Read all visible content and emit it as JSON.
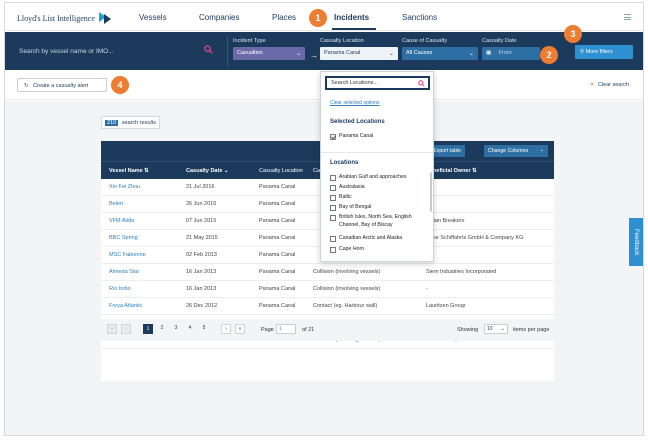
{
  "app": {
    "title": "Lloyd's List Intelligence"
  },
  "nav": {
    "items": [
      {
        "label": "Vessels"
      },
      {
        "label": "Companies"
      },
      {
        "label": "Places"
      },
      {
        "label": "Incidents"
      },
      {
        "label": "Sanctions"
      }
    ]
  },
  "search": {
    "placeholder": "Search by vessel name or IMO..."
  },
  "filters": {
    "incident_type": {
      "label": "Incident Type",
      "value": "Casualties"
    },
    "casualty_location": {
      "label": "Casualty Location",
      "value": "Panama Canal"
    },
    "cause": {
      "label": "Cause of Casualty",
      "value": "All Causes"
    },
    "date": {
      "label": "Casualty Date",
      "value": "From"
    },
    "more_label": "More filters"
  },
  "toolbar": {
    "alert_label": "Create a casualty alert",
    "clear_label": "Clear search"
  },
  "results": {
    "count": "210",
    "label": "search results"
  },
  "table": {
    "export_label": "Export table",
    "columns_label": "Change Columns",
    "headers": {
      "vessel": "Vessel Name",
      "date": "Casualty Date",
      "location": "Casualty Location",
      "type": "Casualty Type",
      "owner": "Beneficial Owner"
    },
    "rows": [
      {
        "vessel": "Xin Fei Zhou",
        "date": "21 Jul 2016",
        "location": "Panama Canal",
        "type": "",
        "owner": ""
      },
      {
        "vessel": "Belen",
        "date": "26 Jun 2016",
        "location": "Panama Canal",
        "type": "",
        "owner": ""
      },
      {
        "vessel": "VFM Alida",
        "date": "07 Jun 2015",
        "location": "Panama Canal",
        "type": "",
        "owner": "Indian Breakers"
      },
      {
        "vessel": "BBC Spring",
        "date": "21 May 2015",
        "location": "Panama Canal",
        "type": "",
        "owner": "Hese Schiffahrts GmbH & Company KG"
      },
      {
        "vessel": "MSC Fabienne",
        "date": "02 Feb 2013",
        "location": "Panama Canal",
        "type": "",
        "owner": ""
      },
      {
        "vessel": "Almeda Star",
        "date": "16 Jan 2013",
        "location": "Panama Canal",
        "type": "Collision (involving vessels)",
        "owner": "Siem Industries Incorporated"
      },
      {
        "vessel": "Rio Indio",
        "date": "16 Jan 2013",
        "location": "Panama Canal",
        "type": "Collision (involving vessels)",
        "owner": "-"
      },
      {
        "vessel": "Freya Atlantic",
        "date": "26 Dec 2012",
        "location": "Panama Canal",
        "type": "Contact (eg. Harbour wall)",
        "owner": "Lauritzen Group"
      },
      {
        "vessel": "Coastal Renaissance",
        "date": "21 Nov 2007",
        "location": "Panama Canal",
        "type": "Contact (eg. Harbour wall)",
        "owner": "-"
      },
      {
        "vessel": "Miltiades",
        "date": "24 Jul 2007",
        "location": "Panama Canal",
        "type": "Collision (involving vessels)",
        "owner": "Nicholas Papalios"
      }
    ]
  },
  "pager": {
    "pages": [
      "1",
      "2",
      "3",
      "4",
      "5"
    ],
    "page_label": "Page",
    "page_value": "1",
    "of_label": "of 21",
    "showing_label": "Showing",
    "per_page": "10",
    "per_page_label": "items per page"
  },
  "dropdown": {
    "search_placeholder": "Search Locations...",
    "clear_label": "Clear selected options",
    "selected_heading": "Selected Locations",
    "selected": [
      "Panama Canal"
    ],
    "locations_heading": "Locations",
    "locations": [
      "Arabian Gulf and approaches",
      "Australasia",
      "Baltic",
      "Bay of Bengal",
      "British Isles, North Sea, English Channel, Bay of Biscay",
      "Canadian Arctic and Alaska",
      "Cape Horn"
    ]
  },
  "feedback_label": "Feedback",
  "callouts": [
    "1",
    "2",
    "3",
    "4"
  ],
  "colors": {
    "navy": "#1b3a5c",
    "accent": "#ed7d31",
    "link": "#2e7fc0",
    "button": "#2e8fd1"
  }
}
